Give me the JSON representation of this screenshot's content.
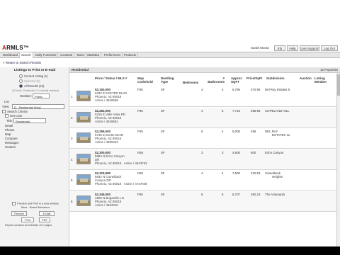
{
  "logo": {
    "prefix": "A",
    "name": "RMLS",
    "suffix": "™"
  },
  "user": {
    "name": "Sarah Moran"
  },
  "top_buttons": [
    "Inb",
    "Help",
    "Live Support",
    "Log Out"
  ],
  "menu": [
    "Dashboard",
    "Search",
    "Daily Functions",
    "Contacts",
    "Taxes",
    "Statistics",
    "Preferences",
    "Products"
  ],
  "menu_active_index": 1,
  "return_link": "« Return to Search Results",
  "left": {
    "title": "Listings to Print or E-mail",
    "options": [
      "Current Listing (1)",
      "Selected (0)",
      "All Results (15)"
    ],
    "selected_option_index": 2,
    "hint": "(15 total / 15 selected / 0 currently selected)",
    "member_label": "Member:",
    "member_value": "Public",
    "list_label": "List",
    "view_label": "View:",
    "view_value": "[2 - Residential View]",
    "search_criteria": "Search Criteria",
    "one_line_label": "One Line",
    "title_label": "Title:",
    "title_value": "Residential",
    "sections": [
      "Detail",
      "Photos",
      "Map",
      "Compare",
      "Messages",
      "Heaters"
    ],
    "footer_check": "Preview and Print in a new window",
    "save_reset": "Save · Reset Selections",
    "preview_label": "Preview",
    "email_label": "E-Mail",
    "print_label": "Print",
    "pdf_label": "PDF",
    "report_note": "Report contains an estimate of 2 pages."
  },
  "grid": {
    "title": "Residential",
    "count": "15 Properties",
    "headers": [
      "Price / Status / MLS #",
      "Map Code/Grid",
      "Dwelling Type",
      "Bedrooms",
      "# Bathrooms",
      "Approx SQFT",
      "Price/SqFt",
      "Subdivision",
      "Auction",
      "Listing Member"
    ],
    "rows": [
      {
        "n": "1",
        "price": "$2,150,000",
        "addr": "6332 E EXETER BLVD",
        "city": "Phoenix, AZ 85018",
        "status": "Active / 4846558",
        "map": "P36",
        "type": "SF",
        "beds": "4",
        "baths": "4",
        "sqft": "5,796",
        "psf": "370.95",
        "sub": "Del Ray Estates 5",
        "sub2": ""
      },
      {
        "n": "2",
        "price": "$2,282,000",
        "addr": "5315 E Valle Vista RD",
        "city": "Phoenix, AZ 85018",
        "status": "Active / 4849581",
        "map": "P36",
        "type": "SF",
        "beds": "4",
        "baths": "5",
        "sqft": "7,710",
        "psf": "295.98",
        "sub": "COPELAND HILL",
        "sub2": ""
      },
      {
        "n": "3",
        "price": "$2,285,000",
        "addr": "5745 E Exeter BLVD",
        "city": "Phoenix, AZ 85018",
        "status": "Active / 4869423",
        "map": "P35",
        "type": "SF",
        "beds": "5",
        "baths": "4",
        "sqft": "5,000",
        "psf": "458",
        "sub": "DEL RAY",
        "sub2": "ESTATES 11"
      },
      {
        "n": "4",
        "price": "$2,300,000",
        "addr": "5984 N Echo Canyon",
        "city": "DR",
        "status": "Phoenix, AZ 85018 · Active / 4843763",
        "map": "N36",
        "type": "SF",
        "beds": "3",
        "baths": "3",
        "sqft": "4,600",
        "psf": "500",
        "sub": "Echo Canyon",
        "sub2": ""
      },
      {
        "n": "5",
        "price": "$2,329,999",
        "addr": "5632 N Camelback",
        "city": "Canyon DR",
        "status": "Phoenix, AZ 85018 · Active / 4747948",
        "map": "N36",
        "type": "SF",
        "beds": "4",
        "baths": "4",
        "sqft": "7,500",
        "psf": "310.53",
        "sub": "Camelback",
        "sub2": "Heights"
      },
      {
        "n": "6",
        "price": "$2,349,000",
        "addr": "4825 N Bogarello LN",
        "city": "Phoenix, AZ 85018",
        "status": "Active / 4822010",
        "map": "P36",
        "type": "SF",
        "beds": "5",
        "baths": "5",
        "sqft": "6,707",
        "psf": "350.23",
        "sub": "The Vineyards",
        "sub2": ""
      }
    ]
  }
}
